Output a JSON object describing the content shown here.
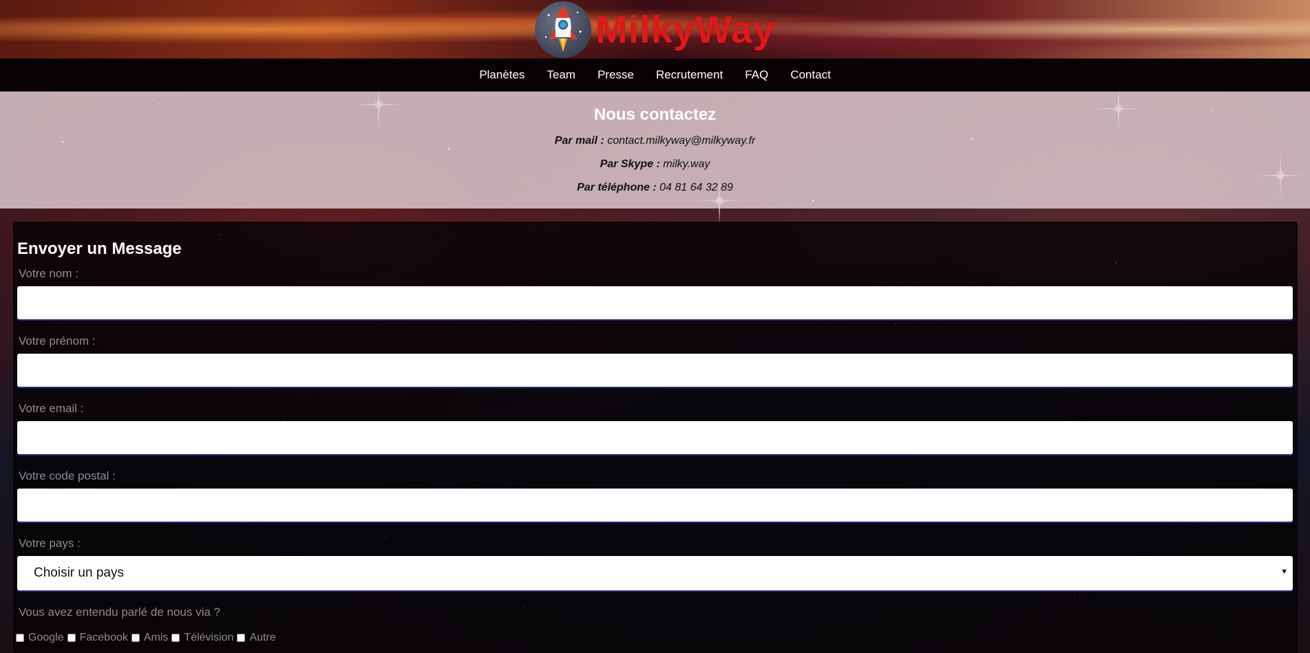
{
  "brand": {
    "name": "MilkyWay",
    "logo_icon": "rocket-icon",
    "accent": "#e01818"
  },
  "nav": {
    "items": [
      {
        "label": "Planètes"
      },
      {
        "label": "Team"
      },
      {
        "label": "Presse"
      },
      {
        "label": "Recrutement"
      },
      {
        "label": "FAQ"
      },
      {
        "label": "Contact"
      }
    ]
  },
  "contact": {
    "title": "Nous contactez",
    "mail_label": "Par mail :",
    "mail_value": "contact.milkyway@milkyway.fr",
    "skype_label": "Par Skype :",
    "skype_value": "milky.way",
    "phone_label": "Par téléphone :",
    "phone_value": "04 81 64 32 89"
  },
  "form": {
    "title": "Envoyer un Message",
    "name_label": "Votre nom :",
    "name_value": "",
    "firstname_label": "Votre prénom :",
    "firstname_value": "",
    "email_label": "Votre email :",
    "email_value": "",
    "postal_label": "Votre code postal :",
    "postal_value": "",
    "country_label": "Votre pays :",
    "country_selected": "Choisir un pays",
    "question": "Vous avez entendu parlé de nous via ?",
    "sources": [
      "Google",
      "Facebook",
      "Amis",
      "Télévision",
      "Autre"
    ]
  }
}
